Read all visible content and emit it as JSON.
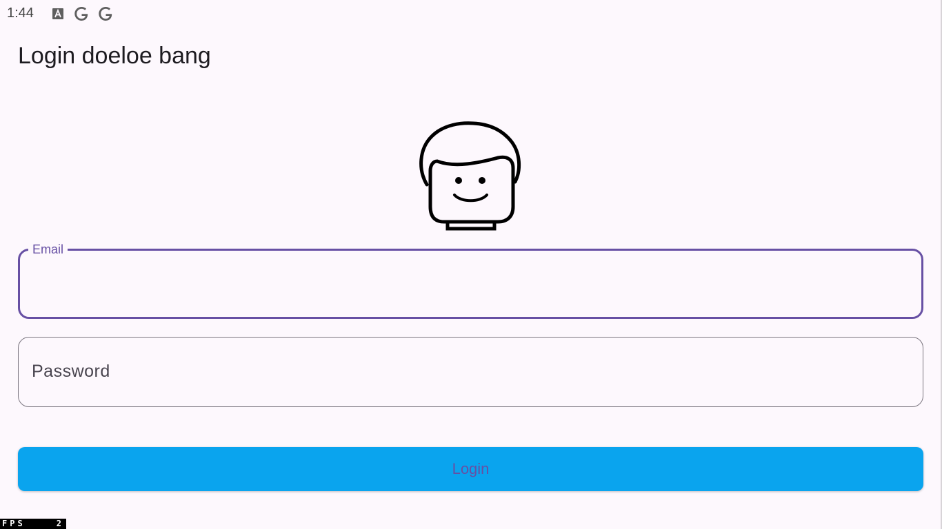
{
  "status_bar": {
    "time": "1:44",
    "icons": [
      "app-a-icon",
      "google-icon",
      "google-icon"
    ]
  },
  "app_bar": {
    "title": "Login doeloe bang"
  },
  "avatar": {
    "icon": "cartoon-face-icon"
  },
  "form": {
    "email": {
      "label": "Email",
      "value": ""
    },
    "password": {
      "placeholder": "Password",
      "value": ""
    },
    "login_label": "Login"
  },
  "debug": {
    "fps_label": "FPS",
    "fps_value": "2"
  },
  "colors": {
    "background": "#fdf8fd",
    "primary": "#6750a4",
    "button": "#0aa4ee",
    "outline": "#79747e"
  }
}
